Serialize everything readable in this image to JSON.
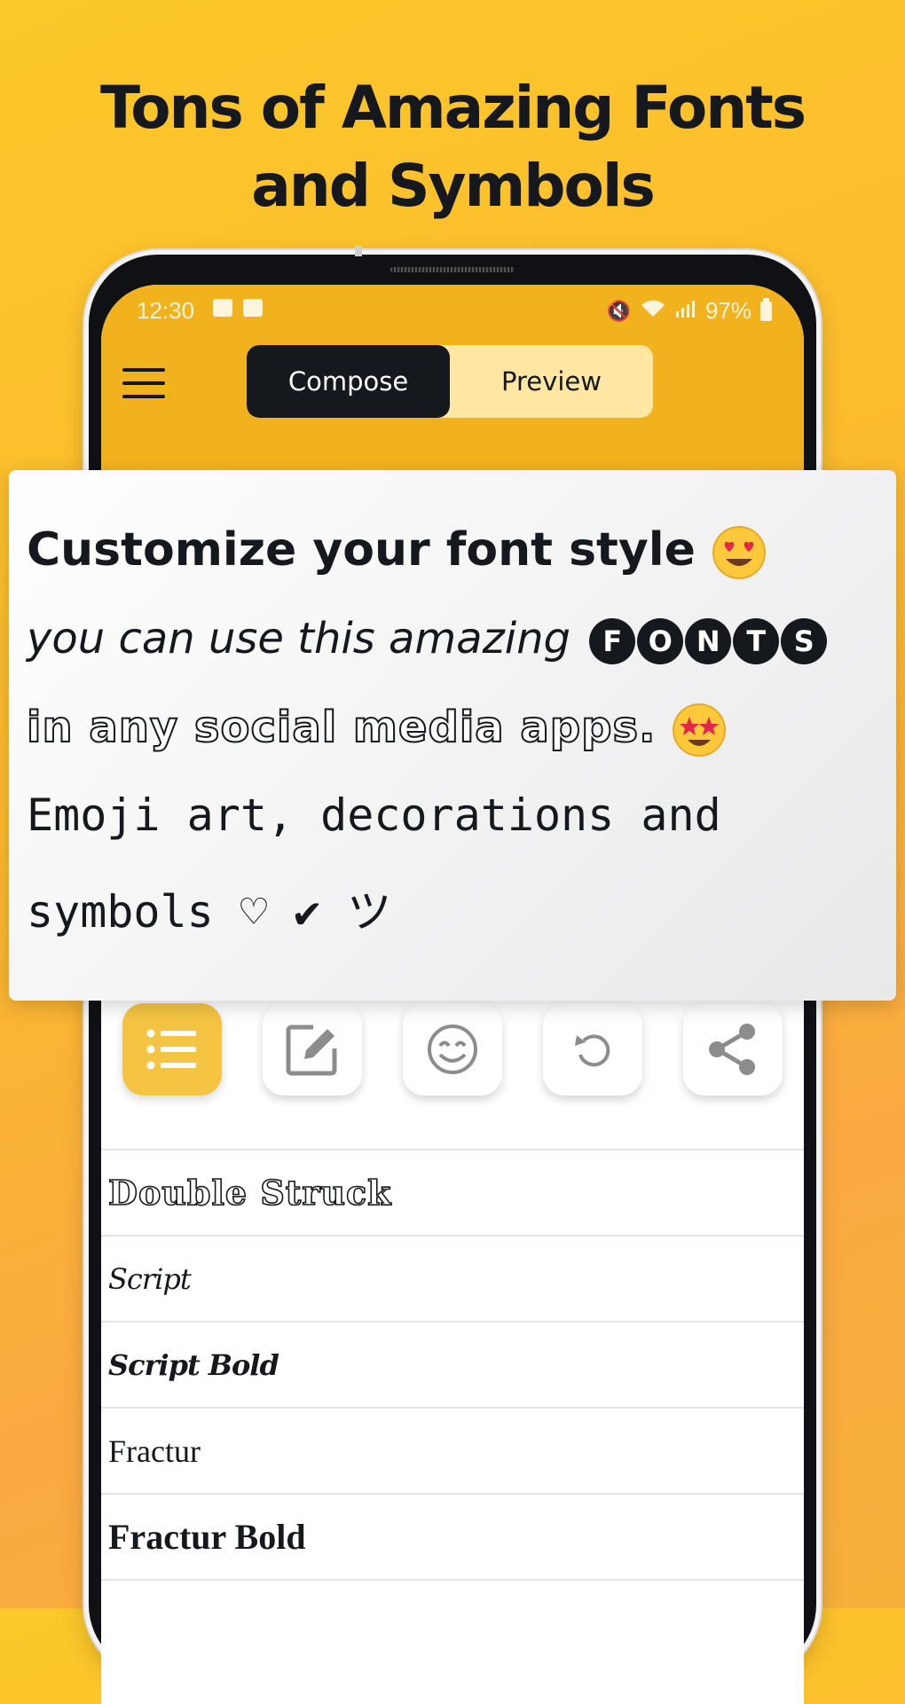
{
  "headline": {
    "line1": "Tons of Amazing Fonts",
    "line2": "and Symbols"
  },
  "status_bar": {
    "time": "12:30",
    "battery": "97%"
  },
  "header": {
    "tabs": [
      {
        "label": "Compose",
        "active": true
      },
      {
        "label": "Preview",
        "active": false
      }
    ]
  },
  "card": {
    "line1": "Customize your font style",
    "line2": "you can use this amazing",
    "line2_letters": [
      "F",
      "O",
      "N",
      "T",
      "S"
    ],
    "line3": "in any social media apps.",
    "line4": "Emoji art, decorations and",
    "line5": "symbols ♡ ✔ ツ"
  },
  "toolbar": {
    "buttons": [
      {
        "icon": "list-icon",
        "active": true
      },
      {
        "icon": "edit-icon",
        "active": false
      },
      {
        "icon": "emoji-icon",
        "active": false
      },
      {
        "icon": "undo-icon",
        "active": false
      },
      {
        "icon": "share-icon",
        "active": false
      }
    ]
  },
  "font_list": {
    "items": [
      {
        "label": "Double Struck"
      },
      {
        "label": "Script"
      },
      {
        "label": "Script Bold"
      },
      {
        "label": "Fractur"
      },
      {
        "label": "Fractur Bold"
      }
    ]
  },
  "colors": {
    "background": "#fbbf2e",
    "header": "#f1b21e",
    "dark": "#15181d",
    "active_tool": "#f5c443"
  }
}
